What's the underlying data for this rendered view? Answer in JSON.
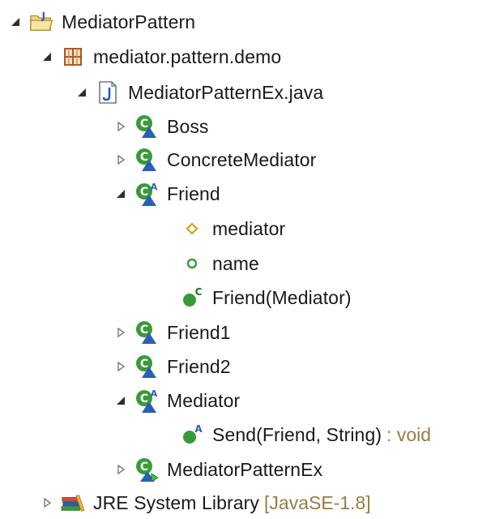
{
  "tree": {
    "project": {
      "label": "MediatorPattern"
    },
    "package": {
      "label": "mediator.pattern.demo"
    },
    "file": {
      "label": "MediatorPatternEx.java"
    },
    "class_boss": {
      "label": "Boss"
    },
    "class_concrete_mediator": {
      "label": "ConcreteMediator"
    },
    "class_friend": {
      "label": "Friend"
    },
    "field_mediator": {
      "label": "mediator"
    },
    "field_name": {
      "label": "name"
    },
    "ctor_friend": {
      "label": "Friend(Mediator)"
    },
    "class_friend1": {
      "label": "Friend1"
    },
    "class_friend2": {
      "label": "Friend2"
    },
    "class_mediator": {
      "label": "Mediator"
    },
    "method_send": {
      "label": "Send(Friend, String)",
      "suffix": ": void"
    },
    "class_main": {
      "label": "MediatorPatternEx"
    },
    "jre_library": {
      "label": "JRE System Library",
      "suffix": "[JavaSE-1.8]"
    }
  },
  "colors": {
    "class_green": "#3a9a3a",
    "triangle_blue": "#2b5fb4",
    "package_brown": "#a8582a",
    "field_gold": "#d9a21b",
    "suffix_text": "#957d47"
  }
}
